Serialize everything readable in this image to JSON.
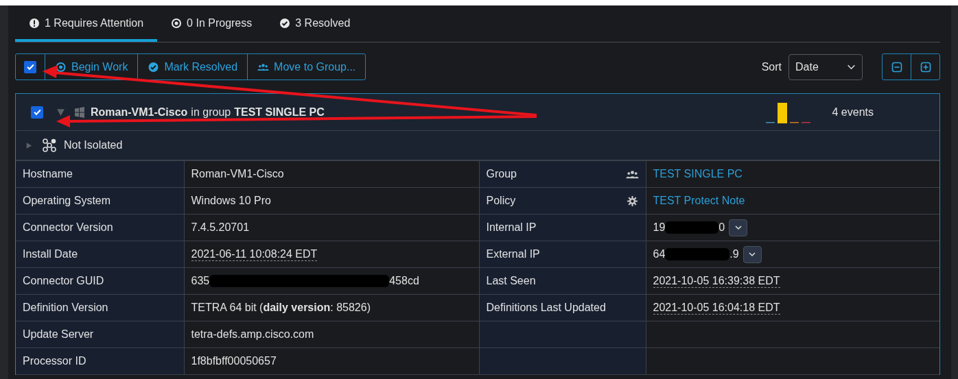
{
  "tabs": [
    {
      "label": "1 Requires Attention",
      "selected": true
    },
    {
      "label": "0 In Progress",
      "selected": false
    },
    {
      "label": "3 Resolved",
      "selected": false
    }
  ],
  "toolbar": {
    "select_all_checked": true,
    "buttons": [
      {
        "label": "Begin Work"
      },
      {
        "label": "Mark Resolved"
      },
      {
        "label": "Move to Group..."
      }
    ],
    "sort_label": "Sort",
    "sort_value": "Date"
  },
  "computer": {
    "checked": true,
    "expanded": true,
    "name": "Roman-VM1-Cisco",
    "group_prefix": "in group",
    "group": "TEST SINGLE PC",
    "events": "4 events",
    "isolation": {
      "label": "Not Isolated",
      "expanded": false
    }
  },
  "details": [
    {
      "label": "Hostname",
      "value": {
        "kind": "text",
        "text": "Roman-VM1-Cisco"
      },
      "label2": "Group",
      "kind": "group",
      "value2": {
        "kind": "link",
        "text": "TEST SINGLE PC"
      }
    },
    {
      "label": "Operating System",
      "value": {
        "kind": "text",
        "text": "Windows 10 Pro"
      },
      "label2": "Policy",
      "kind": "policy",
      "value2": {
        "kind": "link",
        "text": "TEST Protect Note"
      }
    },
    {
      "label": "Connector Version",
      "value": {
        "kind": "text",
        "text": "7.4.5.20701"
      },
      "label2": "Internal IP",
      "value2": {
        "kind": "ip",
        "prefix": "19",
        "suffix": "0"
      }
    },
    {
      "label": "Install Date",
      "value": {
        "kind": "date",
        "text": "2021-06-11 10:08:24 EDT"
      },
      "label2": "External IP",
      "value2": {
        "kind": "ip",
        "prefix": "64",
        "suffix": ".9"
      }
    },
    {
      "label": "Connector GUID",
      "value": {
        "kind": "redacted",
        "prefix": "635",
        "suffix": "458cd"
      },
      "label2": "Last Seen",
      "value2": {
        "kind": "date",
        "text": "2021-10-05 16:39:38 EDT"
      }
    },
    {
      "label": "Definition Version",
      "value": {
        "kind": "rich",
        "text": "TETRA 64 bit (**daily version**: 85826)"
      },
      "label2": "Definitions Last Updated",
      "value2": {
        "kind": "date",
        "text": "2021-10-05 16:04:18 EDT"
      }
    },
    {
      "label": "Update Server",
      "value": {
        "kind": "text",
        "text": "tetra-defs.amp.cisco.com"
      }
    },
    {
      "label": "Processor ID",
      "value": {
        "kind": "text",
        "text": "1f8bfbff00050657"
      }
    }
  ]
}
